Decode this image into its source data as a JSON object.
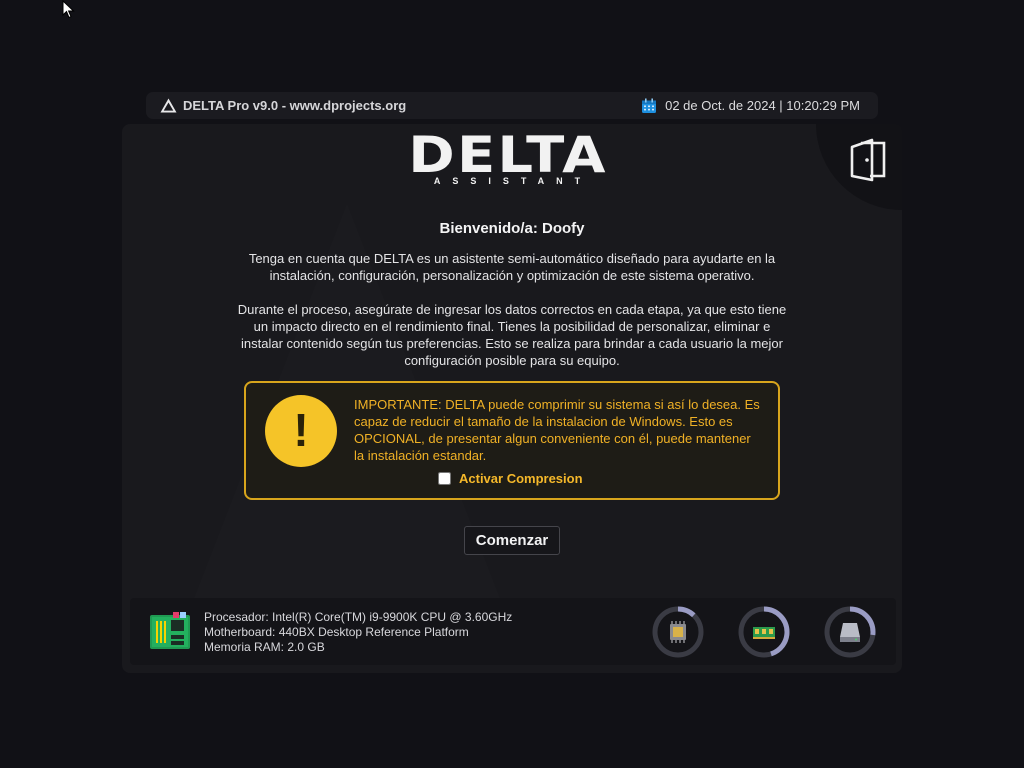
{
  "header": {
    "brand": "DELTA Pro v9.0 - www.dprojects.org",
    "datetime": "02 de Oct. de 2024 | 10:20:29 PM"
  },
  "logo": {
    "main": "DELTA",
    "sub": "ASSISTANT"
  },
  "welcome": {
    "label": "Bienvenido/a:",
    "user": "Doofy"
  },
  "paragraphs": {
    "p1": "Tenga en cuenta que DELTA es un asistente semi-automático diseñado para ayudarte en la instalación, configuración, personalización y optimización de este sistema operativo.",
    "p2": "Durante el proceso, asegúrate de ingresar los datos correctos en cada etapa, ya que esto tiene un impacto directo en el rendimiento final. Tienes la posibilidad de personalizar, eliminar e instalar contenido según tus preferencias. Esto se realiza para brindar a cada usuario la mejor configuración posible para su equipo."
  },
  "warning": {
    "icon": "!",
    "text": "IMPORTANTE: DELTA puede comprimir su sistema si así lo desea. Es capaz de reducir el tamaño de la instalacion de Windows. Esto es OPCIONAL, de presentar algun conveniente con él, puede mantener la instalación estandar.",
    "checkbox_label": "Activar Compresion",
    "checkbox_checked": false
  },
  "start_button": "Comenzar",
  "system": {
    "cpu": "Procesador: Intel(R) Core(TM) i9-9900K CPU @ 3.60GHz",
    "motherboard": "Motherboard: 440BX Desktop Reference Platform",
    "ram": "Memoria RAM: 2.0 GB"
  },
  "gauges": [
    {
      "name": "cpu-usage",
      "icon": "cpu-chip-icon",
      "fraction": 0.12
    },
    {
      "name": "ram-usage",
      "icon": "ram-module-icon",
      "fraction": 0.45
    },
    {
      "name": "disk-usage",
      "icon": "hard-drive-icon",
      "fraction": 0.27
    }
  ],
  "colors": {
    "accent_warning": "#f0b126",
    "warning_border": "#d8a51c",
    "gauge_track": "#3a3b44",
    "gauge_fill": "#9a9cc4"
  }
}
